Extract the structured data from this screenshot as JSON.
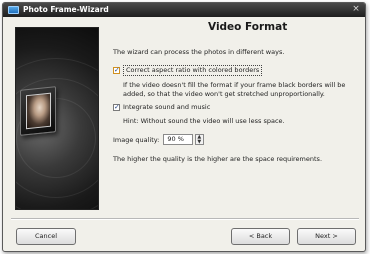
{
  "window": {
    "title": "Photo Frame-Wizard",
    "close_glyph": "×"
  },
  "page": {
    "heading": "Video Format",
    "intro": "The wizard can process the photos in different ways.",
    "option_borders": {
      "label": "Correct aspect ratio with colored borders",
      "checked": true,
      "note": "If the video doesn't fill the format if your frame black borders will be added, so that the video won't get stretched unproportionally."
    },
    "option_sound": {
      "label": "Integrate sound and music",
      "checked": true,
      "note": "Hint: Without sound the video will use less space."
    },
    "quality": {
      "label": "Image quality:",
      "value": "90 %"
    },
    "closing": "The higher the quality is the higher are the space requirements."
  },
  "buttons": {
    "cancel": "Cancel",
    "back": "< Back",
    "next": "Next >"
  }
}
